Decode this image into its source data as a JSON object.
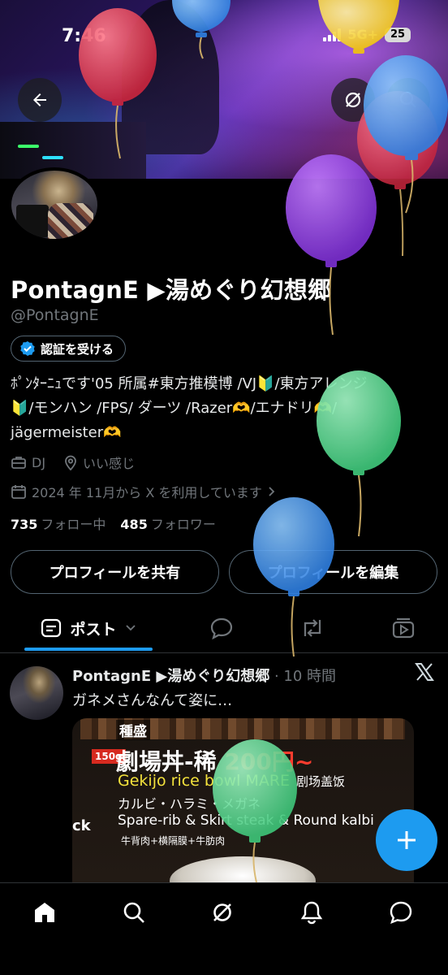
{
  "status": {
    "time": "7:46",
    "network": "5G+",
    "battery": "25"
  },
  "profile": {
    "display_name": "PontagnE ▶湯めぐり幻想郷",
    "handle": "@PontagnE",
    "verify_label": "認証を受ける",
    "bio_lines": [
      "ﾎﾟﾝﾀｰﾆｭです'05 所属#東方推模博 /VJ🔰/東方アレンジ",
      "🔰/モンハン /FPS/ ダーツ /Razer🫶/エナドリ🫶/",
      "jägermeister🫶"
    ],
    "category": "DJ",
    "location": "いい感じ",
    "joined": "2024 年 11月から X を利用しています",
    "following_count": "735",
    "following_label": "フォロー中",
    "followers_count": "485",
    "followers_label": "フォロワー"
  },
  "actions": {
    "share_label": "プロフィールを共有",
    "edit_label": "プロフィールを編集"
  },
  "tabs": {
    "posts_label": "ポスト"
  },
  "post": {
    "author": "PontagnE ▶湯めぐり幻想郷",
    "time": "· 10 時間",
    "text": "ガネメさんなんて姿に…",
    "media": {
      "top_label": "種盛",
      "badge": "150g",
      "title": "劇場丼-稀",
      "price": "200円~",
      "english": "Gekijo rice bowl MARE",
      "chinese": "剧场盖饭",
      "japanese": "カルビ・ハラミ・メガネ",
      "english2": "Spare-rib & Skirt steak & Round kalbi",
      "japanese2": "牛背肉+横隔膜+牛肪肉",
      "side": "ck"
    }
  },
  "colors": {
    "accent": "#1d9bf0",
    "muted": "#71767b",
    "border": "#536471"
  },
  "icons": [
    "back-arrow-icon",
    "grok-icon",
    "search-icon",
    "verified-badge-icon",
    "briefcase-icon",
    "location-pin-icon",
    "calendar-icon",
    "chevron-right-icon",
    "posts-tab-icon",
    "chevron-down-icon",
    "reply-tab-icon",
    "repost-tab-icon",
    "video-tab-icon",
    "x-logo-icon",
    "plus-icon",
    "home-icon",
    "grok-nav-icon",
    "bell-icon",
    "messages-icon",
    "balloon"
  ]
}
